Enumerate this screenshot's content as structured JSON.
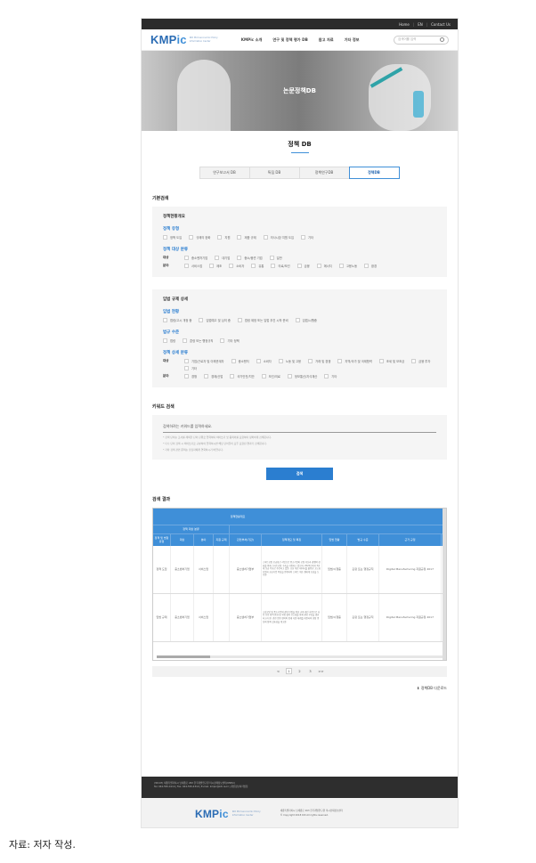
{
  "topbar": {
    "links": [
      "Home",
      "EN",
      "Contact Us"
    ]
  },
  "nav": {
    "logo_main": "KMP",
    "logo_ic": "ic",
    "logo_sub": "KDI Microeconomic Policy Information Center",
    "menu": [
      "KMPic 소개",
      "연구 및 정책 평가 DB",
      "참고 자료",
      "기타 정보"
    ],
    "search_placeholder": "검색어를 입력"
  },
  "hero": {
    "title": "논문정책DB"
  },
  "section_title": "정책 DB",
  "tabs": [
    "연구보고서 DB",
    "특집 DB",
    "정책연구DB",
    "정책DB"
  ],
  "basic_search": {
    "heading": "기본검색",
    "box_title": "정책현황개요",
    "policy_type": {
      "title": "정책 유형",
      "options": [
        "정책 도입",
        "규제의 완화",
        "지원",
        "제품 규제",
        "의사시장 지원 도입",
        "기타"
      ]
    },
    "policy_target": {
      "title": "정책 대상 분류",
      "rows": [
        {
          "label": "대상",
          "options": [
            "중소벤처기업",
            "대기업",
            "중소/중견 기업",
            "일반"
          ]
        },
        {
          "label": "분야",
          "options": [
            "서비스업",
            "제조",
            "소비자",
            "유통",
            "의료/보건",
            "금융",
            "에너지",
            "고용노동",
            "환경"
          ]
        }
      ]
    }
  },
  "regulation": {
    "box_title": "입법 규제 상세",
    "status": {
      "title": "입법 현황",
      "options": [
        "법령/고시 개정 중",
        "입법예고 및 심의 중",
        "법령 제정 또는 입법 추진 시작 준비",
        "입법/시행중"
      ]
    },
    "level": {
      "title": "법규 수준",
      "options": [
        "법령",
        "훈령 또는 행정규칙",
        "기타 정책"
      ]
    },
    "target": {
      "title": "정책 상세 분류",
      "rows": [
        {
          "label": "대상",
          "options": [
            "기업/근로자 및 이해관계자",
            "중소벤처",
            "소비자",
            "노동 및 고용",
            "거래 및 경쟁",
            "지역/국가 및 국제협력",
            "조세 및 보조금",
            "금융 투자",
            "기타"
          ]
        },
        {
          "label": "분야",
          "options": [
            "경쟁",
            "경제/산업",
            "국가안전/치안",
            "보건/의료",
            "정보통신/지식재산",
            "기타"
          ]
        }
      ]
    }
  },
  "keyword": {
    "heading": "키워드 검색",
    "placeholder": "검색하려는 키워드를 입력하세요.",
    "notes": [
      "* 검색 단어는 조사를 제외한 단어 단위로 입력하며 띄어쓰기 및 동의어를 포함하여 정확하게 검색됩니다.",
      "* 다수 단어 검색 시 띄어쓰기로 구분하여 입력하시면 해당 단어들이 모두 포함된 결과가 검색됩니다.",
      "* 기타 검색 관련 문의는 담당자에게 연락하시기 바랍니다."
    ],
    "button": "검색"
  },
  "results": {
    "heading": "검색 결과",
    "group1": "정책현황개요",
    "group2": "정책 대상 분류",
    "columns": [
      "정책 및 법령 유형",
      "대상",
      "분야",
      "지원 규제",
      "관련부처(기관)",
      "정책개요 및 특징",
      "입법 현황",
      "법규 수준",
      "근거 규정"
    ],
    "rows": [
      {
        "type": "정책 도입",
        "target": "중소벤처기업",
        "field": "서비스업",
        "support": "",
        "agency": "중소벤처기업부",
        "summary": "스마트공장 보급확산 사업으로 중소기업의 공정 혁신과 경쟁력 강화를 위해 스마트공장 구축을 지원하고 있으며, 2022년까지 3만개 보급 목표로 추진하고 있음. 또한 제조 데이터를 활용한 고도화 지원과 공급기업 육성을 병행하여 스마트 제조 생태계 조성을 도모함.",
        "status": "입법/시행중",
        "level": "훈령 또는 행정규칙",
        "basis": "Digital Manufacturing 지원규정 2017"
      },
      {
        "type": "입법 규제",
        "target": "중소벤처기업",
        "field": "서비스업",
        "support": "",
        "agency": "중소벤처기업부",
        "summary": "소상공인 및 중소기업의 경영 안정을 위한 규제 개선 사항으로 사업 진입 장벽 완화 및 행정 절차 간소화를 통해 경영 부담을 경감하고자 함. 관련 법령 정비와 함께 지원 체계를 개편하여 현장 중심의 정책 실효성을 제고함.",
        "status": "입법/시행중",
        "level": "훈령 또는 행정규칙",
        "basis": "Digital Manufacturing 지원규정 2017"
      }
    ],
    "pages": [
      "<",
      "1",
      "2",
      "3",
      ">>"
    ],
    "current_page": "1",
    "download": "정책DB 다운로드"
  },
  "footer": {
    "dark_lines": [
      "(30147) 세종특별자치시 남세종로 263 한국개발연구원 미시경제정보센터(KMPic)",
      "Tel. 044-550-4114 | Fax. 044-550-4310 | E-mail. kmpic@kdi.re.kr | 개인정보처리방침"
    ],
    "info_lines": [
      "세종특별자치시 남세종로 263 한국개발연구원 미시경제정보센터",
      "© Copyright 2018 KDI All rights reserved."
    ]
  },
  "caption": "자료: 저자 작성."
}
